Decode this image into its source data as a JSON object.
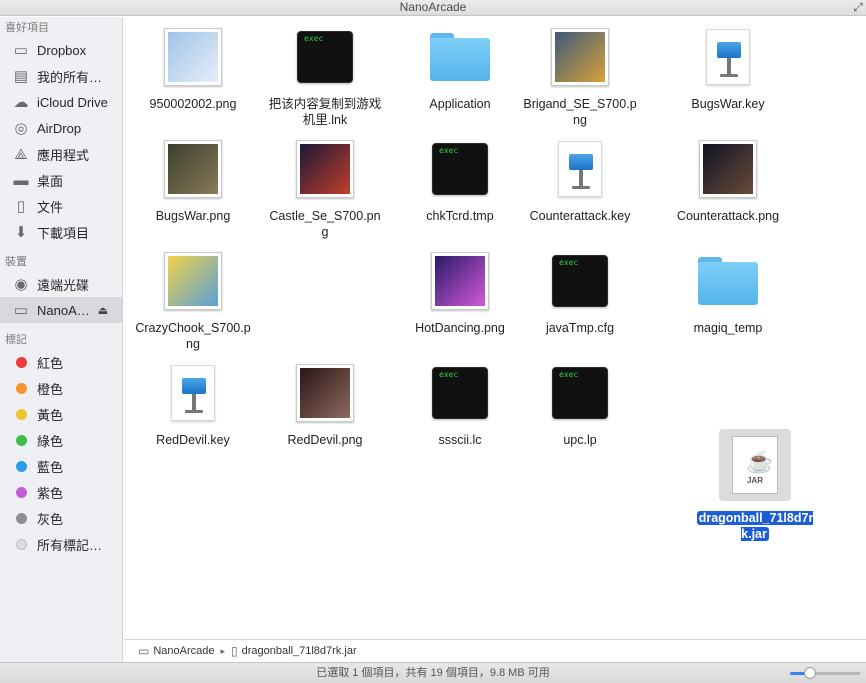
{
  "window": {
    "title": "NanoArcade"
  },
  "sidebar": {
    "favorites_header": "喜好項目",
    "favorites": [
      {
        "label": "Dropbox",
        "icon": "folder-icon"
      },
      {
        "label": "我的所有…",
        "icon": "all-files-icon"
      },
      {
        "label": "iCloud Drive",
        "icon": "cloud-icon"
      },
      {
        "label": "AirDrop",
        "icon": "airdrop-icon"
      },
      {
        "label": "應用程式",
        "icon": "applications-icon"
      },
      {
        "label": "桌面",
        "icon": "desktop-icon"
      },
      {
        "label": "文件",
        "icon": "documents-icon"
      },
      {
        "label": "下載項目",
        "icon": "downloads-icon"
      }
    ],
    "devices_header": "裝置",
    "devices": [
      {
        "label": "遠端光碟",
        "icon": "disc-icon"
      },
      {
        "label": "NanoA…",
        "icon": "drive-icon",
        "selected": true
      }
    ],
    "tags_header": "標記",
    "tags": [
      {
        "label": "紅色",
        "color": "#ee3b3b"
      },
      {
        "label": "橙色",
        "color": "#f5952b"
      },
      {
        "label": "黃色",
        "color": "#eec42a"
      },
      {
        "label": "綠色",
        "color": "#3dbe4a"
      },
      {
        "label": "藍色",
        "color": "#2e9be6"
      },
      {
        "label": "紫色",
        "color": "#c45ed6"
      },
      {
        "label": "灰色",
        "color": "#8e8e93"
      },
      {
        "label": "所有標記…",
        "color": "#dcdcdc"
      }
    ]
  },
  "files": [
    {
      "name": "950002002.png",
      "kind": "image",
      "colors": [
        "#9fc4e8",
        "#e6eef8"
      ]
    },
    {
      "name": "把该内容复制到游戏机里.lnk",
      "kind": "terminal",
      "term_text": "exec"
    },
    {
      "name": "Application",
      "kind": "folder"
    },
    {
      "name": "Brigand_SE_S700.png",
      "kind": "image",
      "colors": [
        "#3f5a7a",
        "#d7a13a"
      ]
    },
    {
      "name": "BugsWar.key",
      "kind": "keynote"
    },
    {
      "name": "BugsWar.png",
      "kind": "image",
      "colors": [
        "#3a3f2e",
        "#8a7a58"
      ]
    },
    {
      "name": "Castle_Se_S700.png",
      "kind": "image",
      "colors": [
        "#1b1836",
        "#c23f2a"
      ]
    },
    {
      "name": "chkTcrd.tmp",
      "kind": "terminal",
      "term_text": "exec"
    },
    {
      "name": "Counterattack.key",
      "kind": "keynote"
    },
    {
      "name": "Counterattack.png",
      "kind": "image",
      "colors": [
        "#101524",
        "#6a4a3a"
      ]
    },
    {
      "name": "CrazyChook_S700.png",
      "kind": "image",
      "colors": [
        "#f2d24a",
        "#5aa0d8"
      ]
    },
    {
      "name": "HotDancing.png",
      "kind": "image",
      "colors": [
        "#2a1a6a",
        "#d25ad8"
      ]
    },
    {
      "name": "javaTmp.cfg",
      "kind": "terminal",
      "term_text": "exec"
    },
    {
      "name": "magiq_temp",
      "kind": "folder"
    },
    {
      "name": "RedDevil.key",
      "kind": "keynote"
    },
    {
      "name": "RedDevil.png",
      "kind": "image",
      "colors": [
        "#2a1416",
        "#8e6a5e"
      ]
    },
    {
      "name": "ssscii.lc",
      "kind": "terminal",
      "term_text": "exec"
    },
    {
      "name": "upc.lp",
      "kind": "terminal",
      "term_text": "exec"
    },
    {
      "name": "dragonball_71l8d7rk.jar",
      "kind": "jar",
      "selected": true,
      "jar_label": "JAR"
    }
  ],
  "pathbar": {
    "items": [
      {
        "label": "NanoArcade",
        "icon": "drive-icon"
      },
      {
        "label": "dragonball_71l8d7rk.jar",
        "icon": "jar-file-icon"
      }
    ]
  },
  "statusbar": {
    "text": "已選取 1 個項目，共有 19 個項目，9.8 MB 可用"
  },
  "icon_size_slider": {
    "value": 0.28
  },
  "accent_color": "#1c5fd4"
}
